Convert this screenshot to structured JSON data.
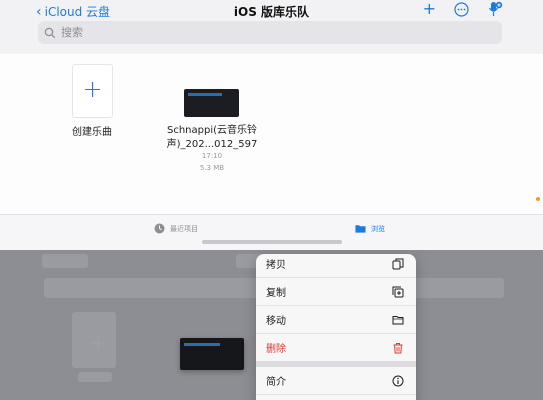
{
  "header": {
    "back_label": "iCloud 云盘",
    "title": "iOS 版库乐队"
  },
  "search": {
    "placeholder": "搜索"
  },
  "items": {
    "create": {
      "label": "创建乐曲"
    },
    "file": {
      "name_line1": "Schnappi(云音乐铃",
      "name_line2": "声)_202...012_597",
      "time": "17:10",
      "size": "5.3 MB"
    }
  },
  "tabs": {
    "recent": "最近项目",
    "browse": "浏览"
  },
  "context_menu": {
    "items": [
      {
        "label": "拷贝",
        "icon": "copy-icon"
      },
      {
        "label": "复制",
        "icon": "duplicate-icon"
      },
      {
        "label": "移动",
        "icon": "folder-icon"
      },
      {
        "label": "删除",
        "icon": "trash-icon"
      },
      {
        "label": "简介",
        "icon": "info-icon"
      }
    ]
  },
  "colors": {
    "accent": "#1f7ae0",
    "danger": "#e5362e"
  }
}
